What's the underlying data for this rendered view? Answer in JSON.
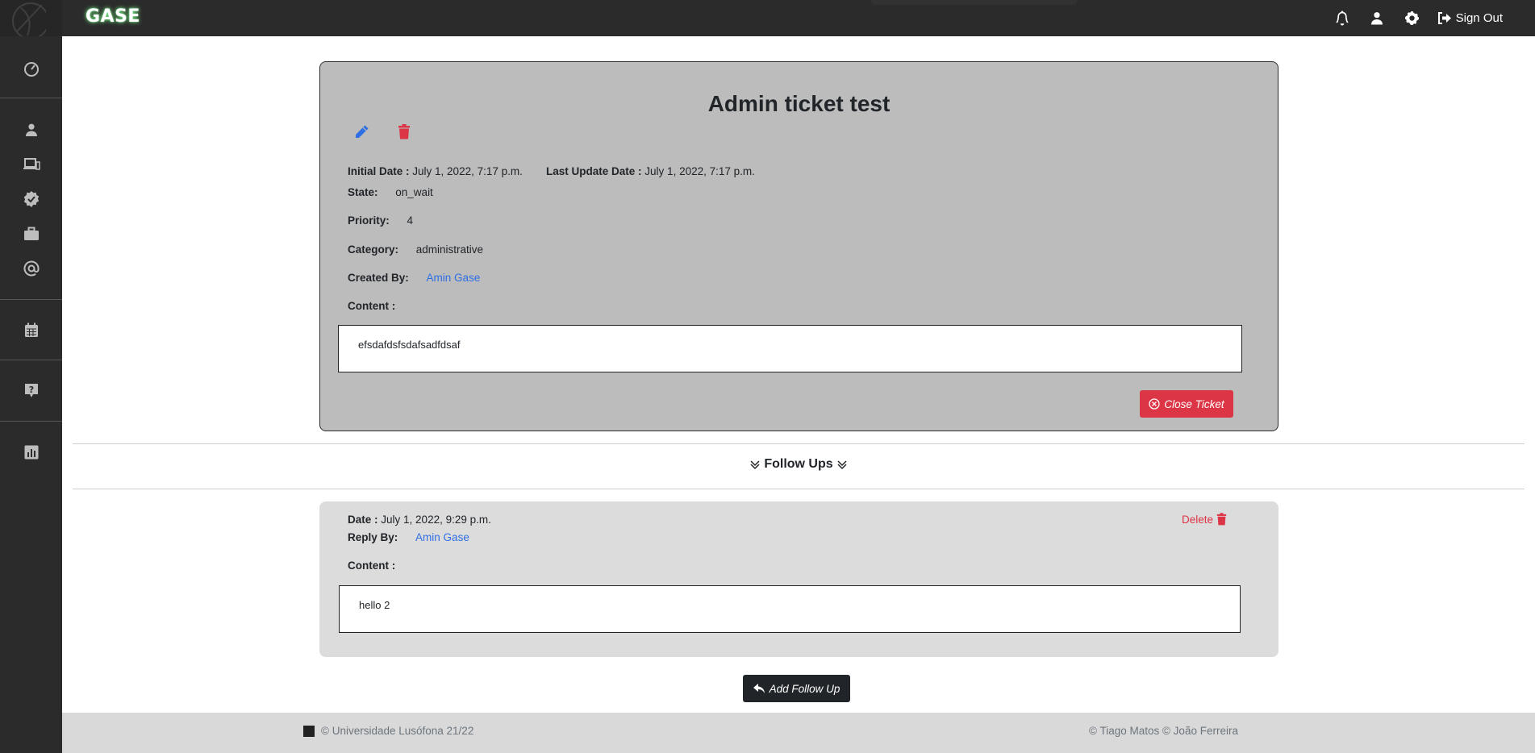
{
  "app": {
    "brand": "GASE"
  },
  "header": {
    "icons": [
      "bell-icon",
      "user-icon",
      "gear-icon",
      "sign-out-icon"
    ],
    "signout_label": "Sign Out"
  },
  "sidebar": {
    "items": [
      {
        "name": "dashboard",
        "icon": "speedometer-icon"
      },
      {
        "name": "users",
        "icon": "user-icon"
      },
      {
        "name": "devices",
        "icon": "laptop-icon"
      },
      {
        "name": "verified",
        "icon": "badge-check-icon"
      },
      {
        "name": "services",
        "icon": "briefcase-icon"
      },
      {
        "name": "emails",
        "icon": "at-icon"
      },
      {
        "name": "calendar",
        "icon": "calendar-icon"
      },
      {
        "name": "help",
        "icon": "question-icon"
      },
      {
        "name": "reports",
        "icon": "chart-icon"
      }
    ]
  },
  "ticket": {
    "title": "Admin ticket test",
    "initial_date_label": "Initial Date :",
    "initial_date": "July 1, 2022, 7:17 p.m.",
    "last_update_label": "Last Update Date :",
    "last_update": "July 1, 2022, 7:17 p.m.",
    "state_label": "State:",
    "state": "on_wait",
    "priority_label": "Priority:",
    "priority": "4",
    "category_label": "Category:",
    "category": "administrative",
    "created_by_label": "Created By:",
    "created_by": "Amin Gase",
    "content_label": "Content :",
    "content": "efsdafdsfsdafsadfdsaf",
    "close_label": "Close Ticket"
  },
  "followups": {
    "heading": "Follow Ups",
    "items": [
      {
        "date_label": "Date :",
        "date": "July 1, 2022, 9:29 p.m.",
        "reply_label": "Reply By:",
        "reply_by": "Amin Gase",
        "content_label": "Content :",
        "content": "hello 2",
        "delete_label": "Delete"
      }
    ],
    "add_label": "Add Follow Up"
  },
  "footer": {
    "left": "© Universidade Lusófona 21/22",
    "right": "© Tiago Matos © João Ferreira"
  },
  "colors": {
    "danger": "#dc3545",
    "link": "#2f6fe4",
    "dark": "#212529",
    "sidebar": "#2b2b2b"
  }
}
